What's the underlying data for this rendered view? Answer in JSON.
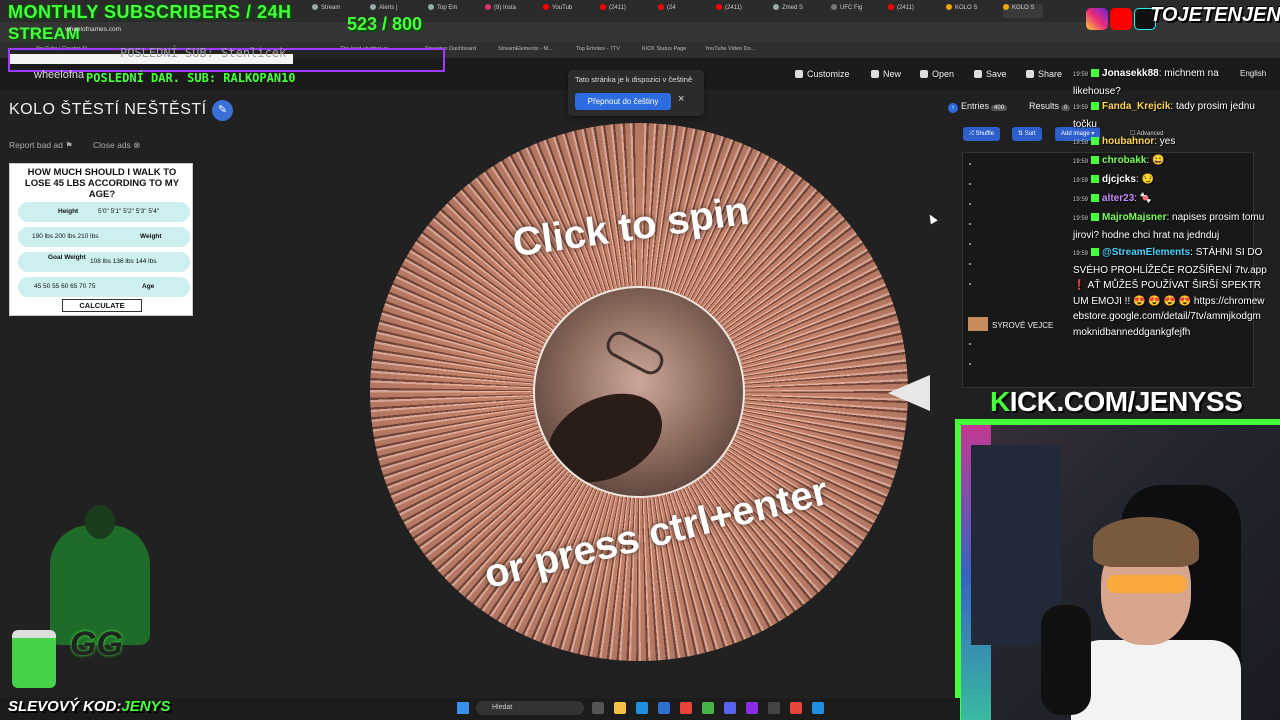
{
  "browser": {
    "tabs": [
      "Stream",
      "Alerts |",
      "Top Em",
      "(9) Insta",
      "YouTub",
      "(2411)",
      "(24",
      "(2411)",
      "Zmed S",
      "UFC Fig",
      "(2411)",
      "KOLO Š",
      "KOLO Š"
    ],
    "address_url": "wheelofnames.com",
    "bookmarks": [
      "YouTube | Creator St...",
      "The best chatbot wi...",
      "Streamer Dashboard",
      "StreamElements - M...",
      "Top Emotes - 7TV",
      "KICK Status Page",
      "YouTube Video Do..."
    ]
  },
  "overlay": {
    "headline": "MONTHLY SUBSCRIBERS / 24H",
    "stream_label": "STREAM",
    "sub_count": "523  / 800",
    "last_sub": "POSLEDNÍ SUB: Stenlicek",
    "last_donation": "POSLEDNÍ DAR. SUB: RALKOPAN10",
    "site_label": "wheelofna",
    "brand": "TOJETENJENYS",
    "kick_url_k": "K",
    "kick_url_rest": "ICK.COM/JENYSS",
    "promo_label": "SLEVOVÝ KOD:",
    "promo_code": "JENYS",
    "mascot_logo": "GG"
  },
  "app": {
    "customize": "Customize",
    "new": "New",
    "open": "Open",
    "save": "Save",
    "share": "Share",
    "language": "English",
    "title": "KOLO ŠTĚSTÍ NEŠTĚSTÍ",
    "report_ad": "Report bad ad",
    "close_ads": "Close ads"
  },
  "ad": {
    "title": "HOW MUCH SHOULD I WALK TO LOSE 45 LBS ACCORDING TO MY AGE?",
    "rows": [
      {
        "label": "Height",
        "values": "5'0\"  5'1\"  5'2\"  5'3\"  5'4\""
      },
      {
        "label": "Weight",
        "values": "190 lbs  200 lbs  210 lbs"
      },
      {
        "label": "Goal Weight",
        "values": "108 lbs  136 lbs  144 lbs"
      },
      {
        "label": "Age",
        "values": "45  50  55  60  65  70  75"
      }
    ],
    "cta": "CALCULATE"
  },
  "wheel": {
    "top_text": "Click to spin",
    "bottom_text": "or press ctrl+enter"
  },
  "translate_popup": {
    "message": "Tato stránka je k dispozici v češtině",
    "button": "Přepnout do češtiny",
    "close": "×"
  },
  "entries": {
    "entries_label": "Entries",
    "entries_count": "400",
    "results_label": "Results",
    "results_count": "0",
    "shuffle": "Shuffle",
    "sort": "Sort",
    "add_image": "Add image",
    "advanced": "Advanced",
    "visible_entry": "SYROVÉ VEJCE"
  },
  "chat": [
    {
      "time": "19:59",
      "user": "Jonasekk88",
      "user_color": "#ffffff",
      "message": ": michnem na likehouse?"
    },
    {
      "time": "19:59",
      "user": "Fanda_Krejcik",
      "user_color": "#ffd64a",
      "message": ": tady prosim jednu točku"
    },
    {
      "time": "19:59",
      "user": "houbahnor",
      "user_color": "#ffd64a",
      "message": ": yes"
    },
    {
      "time": "19:59",
      "user": "chrobakk",
      "user_color": "#7bff5a",
      "message": ": 😀"
    },
    {
      "time": "19:59",
      "user": "djcjcks",
      "user_color": "#ffffff",
      "message": ": 😏"
    },
    {
      "time": "19:59",
      "user": "alter23",
      "user_color": "#c88bff",
      "message": ": 🍬"
    },
    {
      "time": "19:59",
      "user": "MajroMajsner",
      "user_color": "#7bff5a",
      "message": ": napises prosim tomu jirovi? hodne chci hrat na jednduj"
    },
    {
      "time": "19:59",
      "user": "@StreamElements",
      "user_color": "#45d2ff",
      "message": ": STÁHNI SI DO SVÉHO PROHLÍŽEČE ROZŠÍŘENÍ 7tv.app ❗ AŤ MŮŽEŠ POUŽÍVAT ŠIRŠÍ SPEKTRUM EMOJI !! 😍 😍 😍 😍 https://chromewebstore.google.com/detail/7tv/ammjkodgmmoknidbanneddgankgfejfh"
    }
  ],
  "taskbar": {
    "search_placeholder": "Hledat"
  }
}
